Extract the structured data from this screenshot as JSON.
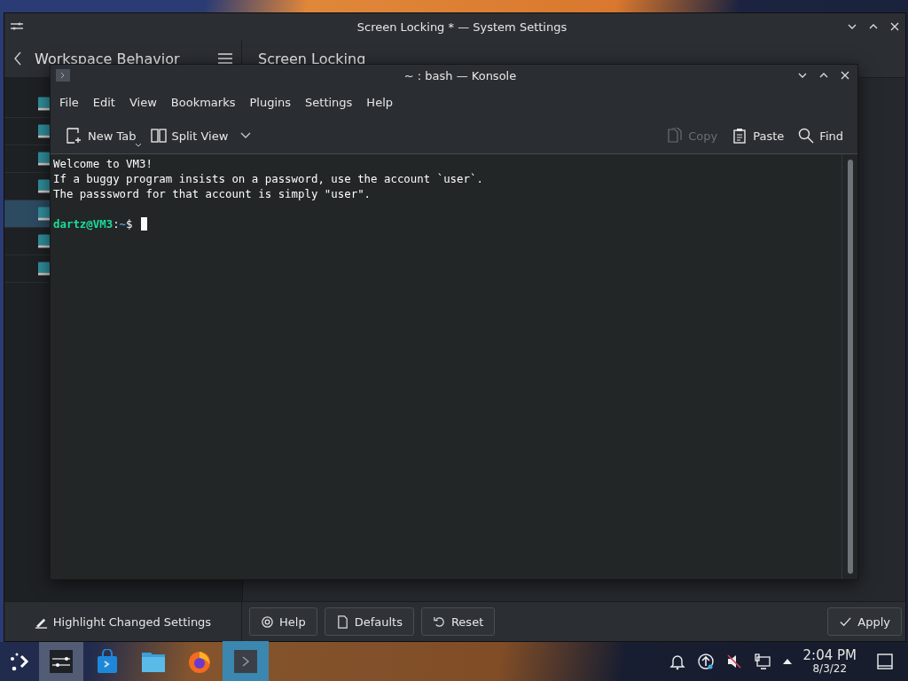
{
  "settings_window": {
    "title": "Screen Locking * — System Settings",
    "back_title": "Workspace Behavior",
    "page_title": "Screen Locking",
    "sidebar": {
      "items": [
        {
          "selected": false
        },
        {
          "selected": false
        },
        {
          "selected": false
        },
        {
          "selected": false
        },
        {
          "selected": true
        },
        {
          "selected": false
        },
        {
          "selected": false
        }
      ]
    },
    "highlight_button": "Highlight Changed Settings",
    "buttons": [
      {
        "kind": "help",
        "label": "Help"
      },
      {
        "kind": "defaults",
        "label": "Defaults"
      },
      {
        "kind": "reset",
        "label": "Reset"
      }
    ],
    "apply_button": "Apply"
  },
  "konsole": {
    "title": "~ : bash — Konsole",
    "menu": [
      "File",
      "Edit",
      "View",
      "Bookmarks",
      "Plugins",
      "Settings",
      "Help"
    ],
    "toolbar_left": [
      {
        "kind": "new-tab",
        "label": "New Tab"
      },
      {
        "kind": "split",
        "label": "Split View"
      }
    ],
    "toolbar_right": [
      {
        "kind": "copy",
        "label": "Copy",
        "disabled": true
      },
      {
        "kind": "paste",
        "label": "Paste",
        "disabled": false
      },
      {
        "kind": "find",
        "label": "Find",
        "disabled": false
      }
    ],
    "lines": [
      "Welcome to VM3!",
      "If a buggy program insists on a password, use the account `user`.",
      "The passsword for that account is simply \"user\"."
    ],
    "prompt": {
      "user_host": "dartz@VM3",
      "colon": ":",
      "path": "~",
      "symbol": "$"
    }
  },
  "taskbar": {
    "tasks": [
      {
        "kind": "settings",
        "open": true,
        "selected": false
      },
      {
        "kind": "store",
        "open": false,
        "selected": false
      },
      {
        "kind": "files",
        "open": false,
        "selected": false
      },
      {
        "kind": "firefox",
        "open": false,
        "selected": false
      },
      {
        "kind": "terminal",
        "open": true,
        "selected": true
      }
    ],
    "clock": {
      "time": "2:04 PM",
      "date": "8/3/22"
    }
  }
}
